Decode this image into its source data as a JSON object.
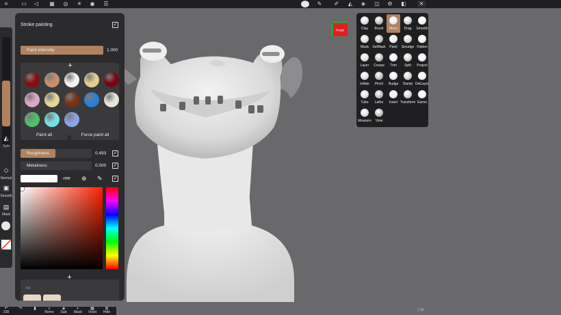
{
  "topbar": {
    "icons": [
      "menu-icon",
      "folder-icon",
      "share-icon",
      "grid-icon",
      "globe-icon",
      "sun-icon",
      "camera-icon",
      "list-icon",
      "matcap-icon",
      "pen-icon",
      "pencil-icon",
      "triangle-icon",
      "layers-icon",
      "gear-icon",
      "puzzle-icon",
      "xmark-icon"
    ]
  },
  "left_strip": {
    "sym_label": "Sym",
    "normal_label": "Normal",
    "smooth_label": "Smooth",
    "mask_label": "Mask",
    "radius_level": 0.25,
    "intensity_level": 0.6
  },
  "panel": {
    "title": "Stroke painting",
    "paint_intensity": {
      "label": "Paint intensity",
      "value": "1.000",
      "level": 1.0
    },
    "swatches": [
      "#8a0c10",
      "#c98f6a",
      "#f2f2f2",
      "#e4cc8e",
      "#7a0610",
      "#dca7c9",
      "#e6d596",
      "#7a3310",
      "#2b7fd8",
      "#e8e4da",
      "#4fbf6a",
      "#79dfe6",
      "#8aa4e8"
    ],
    "paint_all_label": "Paint all",
    "force_paint_all_label": "Force paint all",
    "roughness": {
      "label": "Roughness",
      "value": "0.493",
      "level": 0.493
    },
    "metalness": {
      "label": "Metalness",
      "value": "0.000",
      "level": 0.0
    },
    "hex_value": "#ffffff",
    "base_color": "#ffffff"
  },
  "tools": [
    {
      "label": "Clay",
      "active": false
    },
    {
      "label": "Brush",
      "active": false
    },
    {
      "label": "Move",
      "active": true
    },
    {
      "label": "Drag",
      "active": false
    },
    {
      "label": "Smooth",
      "active": false
    },
    {
      "label": "Mask",
      "active": false
    },
    {
      "label": "SelMask",
      "active": false
    },
    {
      "label": "Paint",
      "active": false
    },
    {
      "label": "Smudge",
      "active": false
    },
    {
      "label": "Flatten",
      "active": false
    },
    {
      "label": "Layer",
      "active": false
    },
    {
      "label": "Crease",
      "active": false
    },
    {
      "label": "Trim",
      "active": false
    },
    {
      "label": "Split",
      "active": false
    },
    {
      "label": "Project",
      "active": false
    },
    {
      "label": "Inflate",
      "active": false
    },
    {
      "label": "Pinch",
      "active": false
    },
    {
      "label": "Nudge",
      "active": false
    },
    {
      "label": "Stamp",
      "active": false
    },
    {
      "label": "DelLayer",
      "active": false
    },
    {
      "label": "Tube",
      "active": false
    },
    {
      "label": "Lathe",
      "active": false
    },
    {
      "label": "Insert",
      "active": false
    },
    {
      "label": "Transform",
      "active": false
    },
    {
      "label": "Gizmo",
      "active": false
    },
    {
      "label": "Measure",
      "active": false
    },
    {
      "label": "View",
      "active": false
    }
  ],
  "view_cube": {
    "label": "Front"
  },
  "bottombar": {
    "items": [
      "238",
      "",
      "",
      "Remo",
      "Sub",
      "Mask",
      "Voxel",
      "Hide"
    ]
  },
  "corner_text": "1.58",
  "colors": {
    "accent": "#b0825f",
    "panel": "#2b2b2e",
    "background": "#6a6a6d"
  }
}
